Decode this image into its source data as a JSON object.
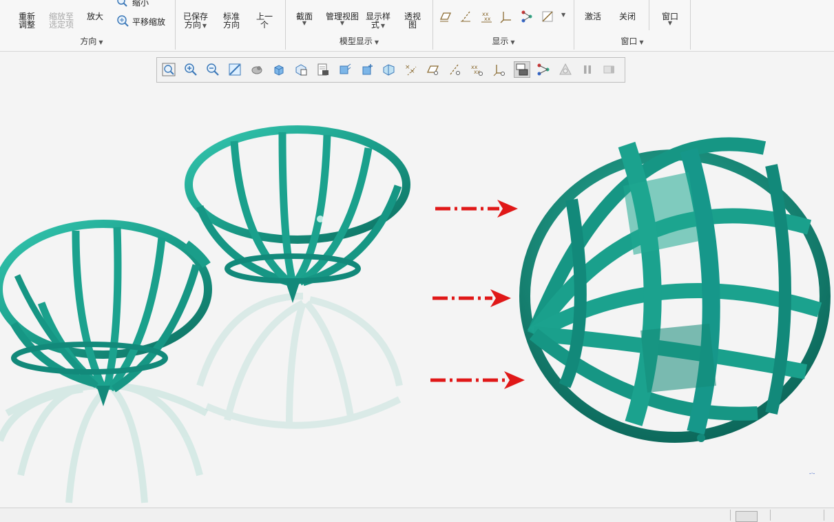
{
  "ribbon": {
    "orientation": {
      "label": "方向",
      "refit_line1": "重新",
      "refit_line2": "调整",
      "zoom_selected_line1": "缩放至",
      "zoom_selected_line2": "选定项",
      "zoom_in": "放大",
      "zoom_out": "缩小",
      "pan_zoom": "平移缩放",
      "saved_line1": "已保存",
      "saved_line2": "方向",
      "standard_line1": "标准",
      "standard_line2": "方向",
      "previous_line1": "上一",
      "previous_line2": "个"
    },
    "model_display": {
      "label": "模型显示",
      "section": "截面",
      "manage_views": "管理视图",
      "display_style_line1": "显示样",
      "display_style_line2": "式",
      "perspective_line1": "透视",
      "perspective_line2": "图"
    },
    "show": {
      "label": "显示"
    },
    "window": {
      "label": "窗口",
      "activate": "激活",
      "close": "关闭",
      "windows": "窗口"
    }
  },
  "icons": {
    "view_toolbar": [
      "zoom-fit-icon",
      "zoom-in-icon",
      "zoom-out-icon",
      "repaint-icon",
      "display-style-icon",
      "saved-orientations-icon",
      "view-manager-icon",
      "spin-center-icon",
      "annotation-display-icon",
      "datum-plane-display-icon",
      "point-display-icon",
      "csys-display-icon",
      "plane-tag-icon",
      "axis-tag-icon",
      "point-tag-icon",
      "csys-tag-icon",
      "active-view-icon",
      "connection-display-icon",
      "appearance-icon",
      "pause-icon",
      "next-icon"
    ]
  },
  "colors": {
    "model_teal": "#1a9e8a",
    "model_dark": "#0d6e60",
    "reflection": "#9fd6cc",
    "arrow_red": "#e01818"
  }
}
